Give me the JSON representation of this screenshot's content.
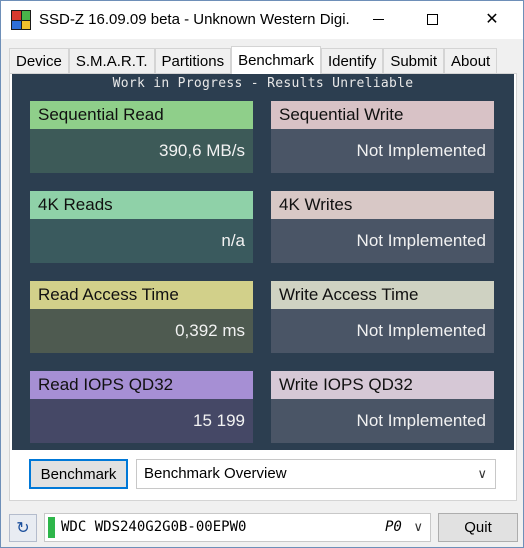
{
  "window": {
    "title": "SSD-Z 16.09.09 beta - Unknown Western Digi...",
    "icon": "ssdz-app-icon"
  },
  "tabs": [
    {
      "label": "Device",
      "active": false
    },
    {
      "label": "S.M.A.R.T.",
      "active": false
    },
    {
      "label": "Partitions",
      "active": false
    },
    {
      "label": "Benchmark",
      "active": true
    },
    {
      "label": "Identify",
      "active": false
    },
    {
      "label": "Submit",
      "active": false
    },
    {
      "label": "About",
      "active": false
    }
  ],
  "benchmark": {
    "banner": "Work in Progress - Results Unreliable",
    "cards": [
      {
        "title": "Sequential Read",
        "value": "390,6 MB/s",
        "head_color": "#8fcf8a",
        "body_color": "#3d5a58"
      },
      {
        "title": "Sequential Write",
        "value": "Not Implemented",
        "head_color": "#d8c2c6",
        "body_color": "#4a5566"
      },
      {
        "title": "4K Reads",
        "value": "n/a",
        "head_color": "#8fd1a8",
        "body_color": "#3a5a5e"
      },
      {
        "title": "4K Writes",
        "value": "Not Implemented",
        "head_color": "#d8c8c6",
        "body_color": "#4a5566"
      },
      {
        "title": "Read Access Time",
        "value": "0,392 ms",
        "head_color": "#d2d08a",
        "body_color": "#4e5a50"
      },
      {
        "title": "Write Access Time",
        "value": "Not Implemented",
        "head_color": "#cfd2c2",
        "body_color": "#4a5566"
      },
      {
        "title": "Read IOPS QD32",
        "value": "15 199",
        "head_color": "#a68fd4",
        "body_color": "#454866"
      },
      {
        "title": "Write IOPS QD32",
        "value": "Not Implemented",
        "head_color": "#d6c8d6",
        "body_color": "#4a5566"
      }
    ],
    "button_label": "Benchmark",
    "overview_selected": "Benchmark Overview"
  },
  "status": {
    "drive_name": "WDC WDS240G2G0B-00EPW0",
    "drive_port": "P0",
    "quit_label": "Quit"
  }
}
